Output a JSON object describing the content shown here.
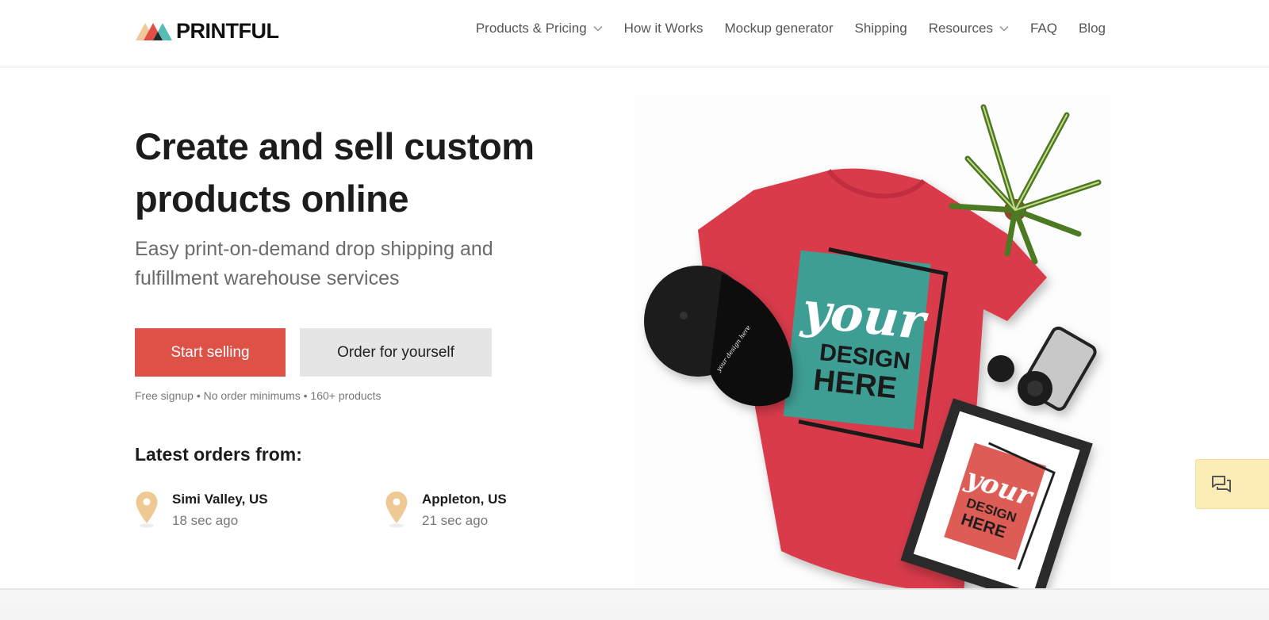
{
  "brand": {
    "name": "PRINTFUL",
    "colors": {
      "peach": "#f0c99a",
      "red": "#e0463d",
      "teal": "#4fb8b0",
      "dark": "#1c2b2b"
    }
  },
  "nav": {
    "items": [
      {
        "label": "Products & Pricing",
        "has_dropdown": true
      },
      {
        "label": "How it Works",
        "has_dropdown": false
      },
      {
        "label": "Mockup generator",
        "has_dropdown": false
      },
      {
        "label": "Shipping",
        "has_dropdown": false
      },
      {
        "label": "Resources",
        "has_dropdown": true
      },
      {
        "label": "FAQ",
        "has_dropdown": false
      },
      {
        "label": "Blog",
        "has_dropdown": false
      }
    ]
  },
  "hero": {
    "title_line1": "Create and sell custom",
    "title_line2": "products online",
    "subtitle": "Easy print-on-demand drop shipping and fulfillment warehouse services",
    "primary_cta": "Start selling",
    "secondary_cta": "Order for yourself",
    "note": "Free signup • No order minimums • 160+ products",
    "image": {
      "alt": "Red t-shirt, black cap, framed print, plant and camera mockup",
      "design_script": "your",
      "design_line1": "DESIGN",
      "design_line2": "HERE",
      "cap_text": "your design here"
    }
  },
  "orders": {
    "title": "Latest orders from:",
    "items": [
      {
        "city": "Simi Valley, US",
        "time": "18 sec ago"
      },
      {
        "city": "Appleton, US",
        "time": "21 sec ago"
      }
    ]
  },
  "colors": {
    "primary_button": "#dd5147",
    "secondary_button": "#e5e5e5",
    "pin": "#efc994",
    "chat_bg": "#fcecb5"
  },
  "chat": {
    "icon": "chat-bubbles-icon"
  }
}
